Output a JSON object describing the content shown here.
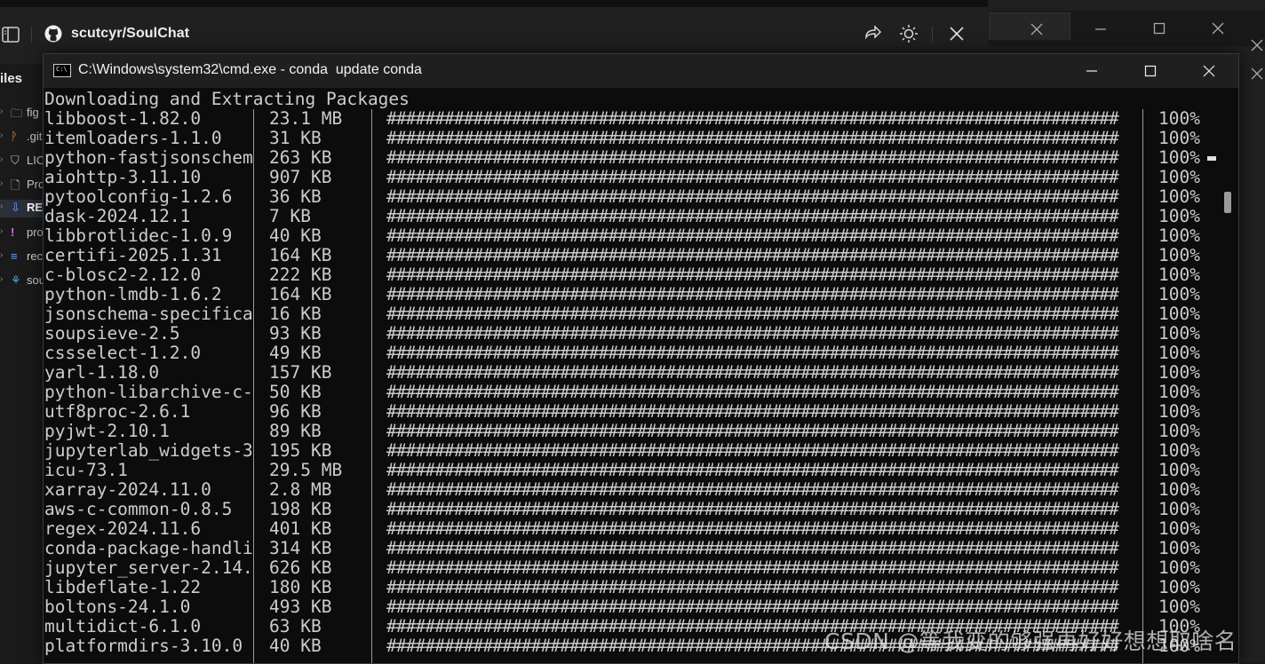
{
  "background_window": {
    "repo_name": "scutcyr/SoulChat",
    "files_label": "iles",
    "files": [
      {
        "name": "fig",
        "icon": "folder-icon"
      },
      {
        "name": ".git",
        "icon": "git-icon"
      },
      {
        "name": "LIC",
        "icon": "shield-icon"
      },
      {
        "name": "Pro",
        "icon": "file-icon"
      },
      {
        "name": "RE",
        "icon": "download-icon"
      },
      {
        "name": "pro",
        "icon": "exclamation-icon"
      },
      {
        "name": "rec",
        "icon": "lines-icon"
      },
      {
        "name": "sou",
        "icon": "python-icon"
      }
    ]
  },
  "cmd": {
    "title": "C:\\Windows\\system32\\cmd.exe - conda  update conda",
    "icon_text": "C:\\",
    "header": "Downloading and Extracting Packages",
    "bar_text": "############################################################################",
    "rows": [
      {
        "name": "libboost-1.82.0",
        "size": "23.1 MB",
        "pct": "100%"
      },
      {
        "name": "itemloaders-1.1.0",
        "size": "31 KB",
        "pct": "100%"
      },
      {
        "name": "python-fastjsonschem",
        "size": "263 KB",
        "pct": "100%"
      },
      {
        "name": "aiohttp-3.11.10",
        "size": "907 KB",
        "pct": "100%"
      },
      {
        "name": "pytoolconfig-1.2.6",
        "size": "36 KB",
        "pct": "100%"
      },
      {
        "name": "dask-2024.12.1",
        "size": "7 KB",
        "pct": "100%"
      },
      {
        "name": "libbrotlidec-1.0.9",
        "size": "40 KB",
        "pct": "100%"
      },
      {
        "name": "certifi-2025.1.31",
        "size": "164 KB",
        "pct": "100%"
      },
      {
        "name": "c-blosc2-2.12.0",
        "size": "222 KB",
        "pct": "100%"
      },
      {
        "name": "python-lmdb-1.6.2",
        "size": "164 KB",
        "pct": "100%"
      },
      {
        "name": "jsonschema-specifica",
        "size": "16 KB",
        "pct": "100%"
      },
      {
        "name": "soupsieve-2.5",
        "size": "93 KB",
        "pct": "100%"
      },
      {
        "name": "cssselect-1.2.0",
        "size": "49 KB",
        "pct": "100%"
      },
      {
        "name": "yarl-1.18.0",
        "size": "157 KB",
        "pct": "100%"
      },
      {
        "name": "python-libarchive-c-",
        "size": "50 KB",
        "pct": "100%"
      },
      {
        "name": "utf8proc-2.6.1",
        "size": "96 KB",
        "pct": "100%"
      },
      {
        "name": "pyjwt-2.10.1",
        "size": "89 KB",
        "pct": "100%"
      },
      {
        "name": "jupyterlab_widgets-3",
        "size": "195 KB",
        "pct": "100%"
      },
      {
        "name": "icu-73.1",
        "size": "29.5 MB",
        "pct": "100%"
      },
      {
        "name": "xarray-2024.11.0",
        "size": "2.8 MB",
        "pct": "100%"
      },
      {
        "name": "aws-c-common-0.8.5",
        "size": "198 KB",
        "pct": "100%"
      },
      {
        "name": "regex-2024.11.6",
        "size": "401 KB",
        "pct": "100%"
      },
      {
        "name": "conda-package-handli",
        "size": "314 KB",
        "pct": "100%"
      },
      {
        "name": "jupyter_server-2.14.",
        "size": "626 KB",
        "pct": "100%"
      },
      {
        "name": "libdeflate-1.22",
        "size": "180 KB",
        "pct": "100%"
      },
      {
        "name": "boltons-24.1.0",
        "size": "493 KB",
        "pct": "100%"
      },
      {
        "name": "multidict-6.1.0",
        "size": "63 KB",
        "pct": "100%"
      },
      {
        "name": "platformdirs-3.10.0",
        "size": "40 KB",
        "pct": "100%"
      }
    ]
  },
  "watermark": "CSDN @等我变的够强再好好想想取啥名"
}
